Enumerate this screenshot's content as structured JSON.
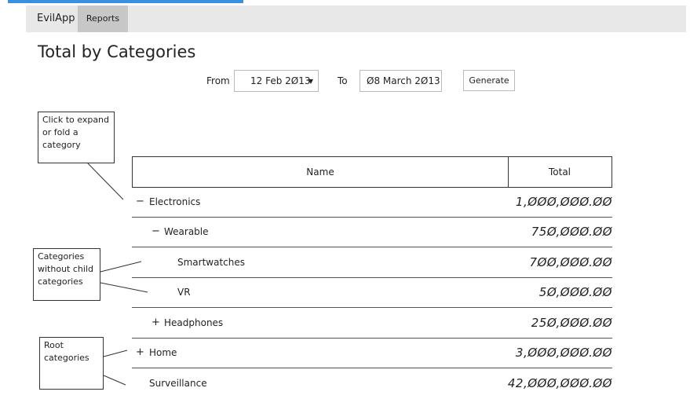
{
  "nav": {
    "brand": "EvilApp",
    "reports": "Reports"
  },
  "page": {
    "title": "Total  by Categories"
  },
  "filters": {
    "from_label": "From",
    "from_value": "12 Feb 2Ø13",
    "to_label": "To",
    "to_value": "Ø8 March 2Ø13",
    "generate": "Generate"
  },
  "notes": {
    "expand": "Click  to expand or fold a category",
    "leaf": "Categories without child categories",
    "root": "Root categories"
  },
  "table": {
    "headers": {
      "name": "Name",
      "total": "Total"
    },
    "rows": [
      {
        "toggle": "−",
        "name": "Electronics",
        "total": "1,ØØØ,ØØØ.ØØ"
      },
      {
        "toggle": "−",
        "name": "Wearable",
        "total": "75Ø,ØØØ.ØØ"
      },
      {
        "toggle": "",
        "name": "Smartwatches",
        "total": "7ØØ,ØØØ.ØØ"
      },
      {
        "toggle": "",
        "name": "VR",
        "total": "5Ø,ØØØ.ØØ"
      },
      {
        "toggle": "+",
        "name": "Headphones",
        "total": "25Ø,ØØØ.ØØ"
      },
      {
        "toggle": "+",
        "name": "Home",
        "total": "3,ØØØ,ØØØ.ØØ"
      },
      {
        "toggle": "",
        "name": "Surveillance",
        "total": "42,ØØØ,ØØØ.ØØ"
      }
    ]
  }
}
